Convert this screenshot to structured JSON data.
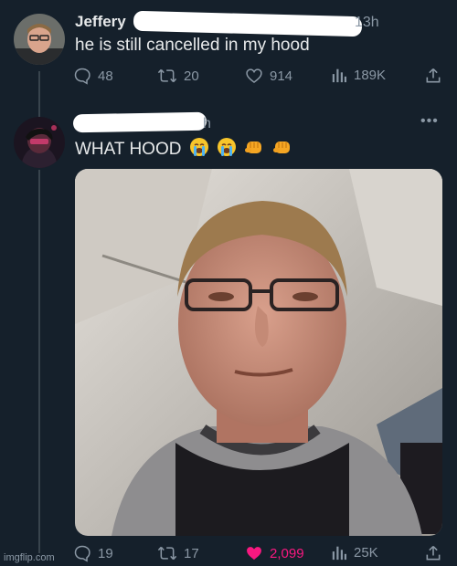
{
  "tweet1": {
    "name": "Jeffery",
    "time": "13h",
    "text": "he is still cancelled in my hood",
    "stats": {
      "replies": "48",
      "retweets": "20",
      "likes": "914",
      "views": "189K"
    }
  },
  "tweet2": {
    "time": "h",
    "text": "WHAT HOOD",
    "emojis": [
      "loudly-crying-face",
      "loudly-crying-face",
      "oncoming-fist",
      "oncoming-fist"
    ],
    "stats": {
      "replies": "19",
      "retweets": "17",
      "likes": "2,099",
      "views": "25K"
    }
  },
  "colors": {
    "background": "#15202b",
    "muted": "#8b98a5",
    "like": "#f91880",
    "line": "#38444d"
  },
  "watermark": "imgflip.com"
}
